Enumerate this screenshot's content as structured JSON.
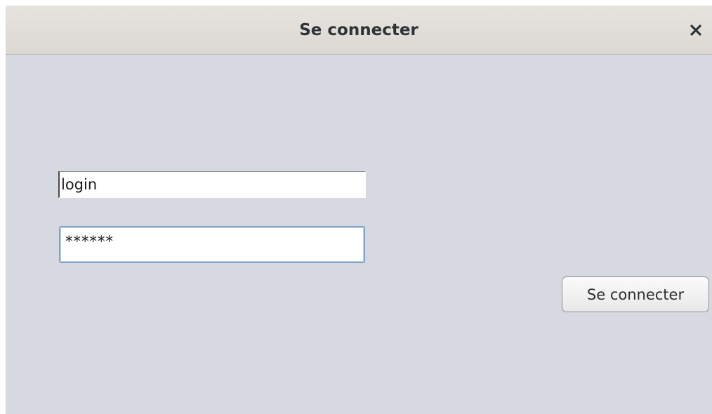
{
  "window": {
    "title": "Se connecter",
    "close_icon": "close-icon"
  },
  "form": {
    "login_value": "login",
    "password_value": "******",
    "submit_label": "Se connecter"
  },
  "colors": {
    "background": "#d6d9e1",
    "titlebar": "#e3e0dc",
    "focus_border": "#7ea3cc"
  }
}
